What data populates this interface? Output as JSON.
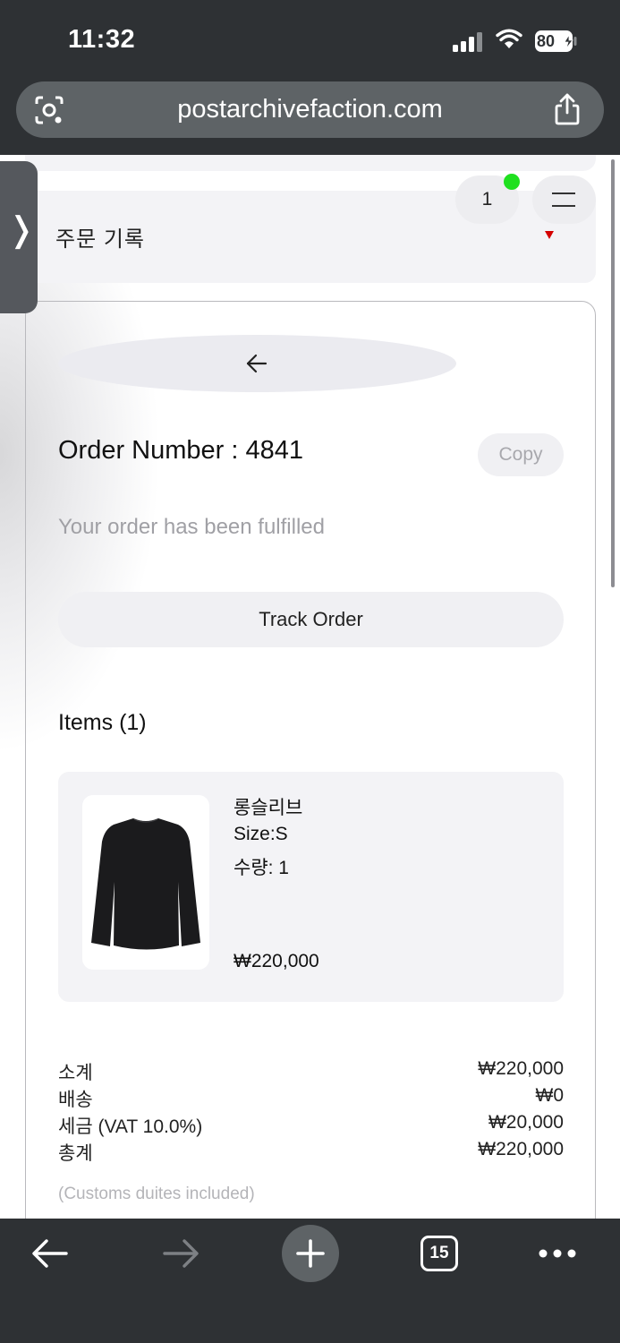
{
  "status_bar": {
    "time": "11:32",
    "battery": "80"
  },
  "browser": {
    "url": "postarchivefaction.com",
    "tab_count": "15"
  },
  "header": {
    "title": "주문 기록",
    "cart_count": "1",
    "side_tab_glyph": "❭"
  },
  "order": {
    "number_label": "Order Number : 4841",
    "copy_label": "Copy",
    "status": "Your order has been fulfilled",
    "track_label": "Track Order",
    "items_heading": "Items (1)"
  },
  "items": [
    {
      "name": "롱슬리브",
      "size": "Size:S",
      "quantity": "수량: 1",
      "price": "₩220,000",
      "image": "black-long-sleeve-shirt"
    }
  ],
  "summary": [
    {
      "label": "소계",
      "value": "₩220,000"
    },
    {
      "label": "배송",
      "value": "₩0"
    },
    {
      "label": "세금 (VAT 10.0%)",
      "value": "₩20,000"
    },
    {
      "label": "총계",
      "value": "₩220,000"
    }
  ],
  "customs_note": "(Customs duites included)",
  "colors": {
    "browser_chrome": "#2e3134",
    "url_bar": "#5e6366",
    "card_bg": "#f3f3f6",
    "cart_dot": "#1fe01f",
    "caret_red": "#d40000"
  }
}
